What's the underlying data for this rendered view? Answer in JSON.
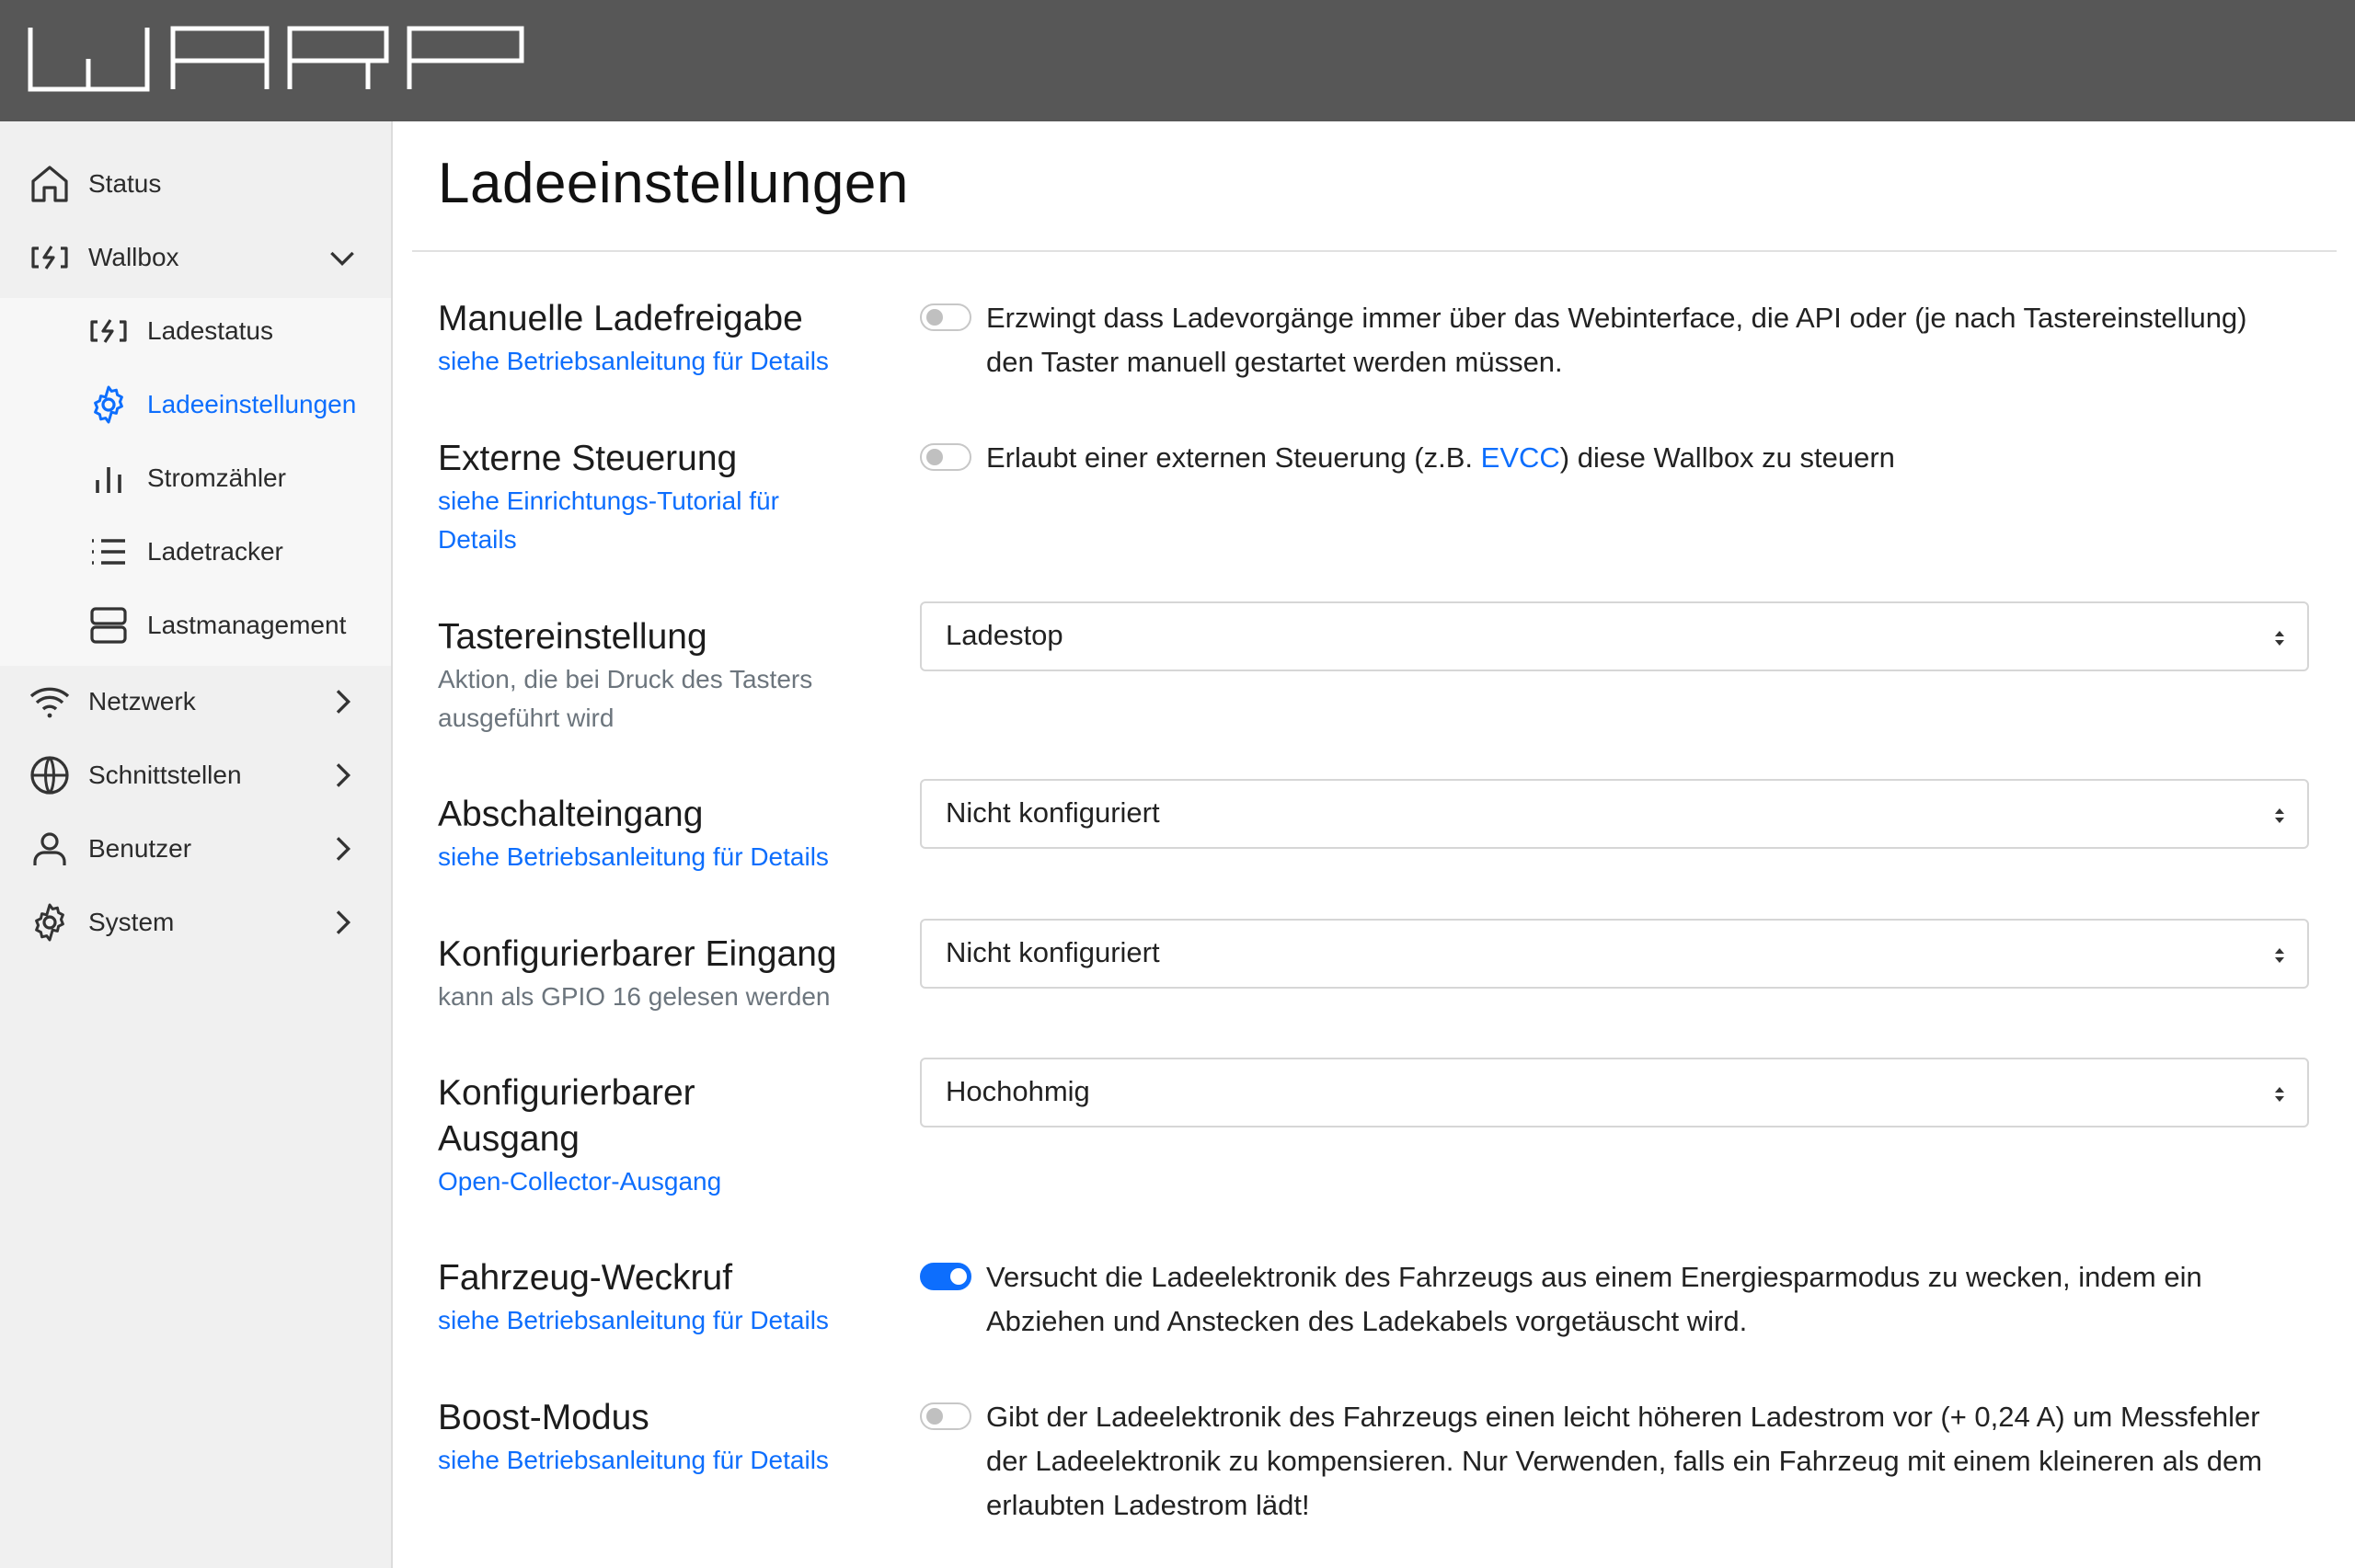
{
  "app": {
    "logo_text": "WARP"
  },
  "sidebar": {
    "items": [
      {
        "label": "Status",
        "icon": "home-icon"
      },
      {
        "label": "Wallbox",
        "icon": "charging-icon"
      },
      {
        "label": "Netzwerk",
        "icon": "wifi-icon"
      },
      {
        "label": "Schnittstellen",
        "icon": "globe-icon"
      },
      {
        "label": "Benutzer",
        "icon": "user-icon"
      },
      {
        "label": "System",
        "icon": "gear-icon"
      }
    ],
    "wallbox_sub": [
      {
        "label": "Ladestatus",
        "icon": "charging-icon"
      },
      {
        "label": "Ladeeinstellungen",
        "icon": "gear-icon",
        "active": true
      },
      {
        "label": "Stromzähler",
        "icon": "bar-chart-icon"
      },
      {
        "label": "Ladetracker",
        "icon": "list-icon"
      },
      {
        "label": "Lastmanagement",
        "icon": "server-icon"
      }
    ]
  },
  "page": {
    "title": "Ladeeinstellungen"
  },
  "settings": {
    "manual": {
      "title": "Manuelle Ladefreigabe",
      "link": "siehe Betriebsanleitung für Details",
      "enabled": false,
      "desc": "Erzwingt dass Ladevorgänge immer über das Webinterface, die API oder (je nach Tastereinstellung) den Taster manuell gestartet werden müssen."
    },
    "external": {
      "title": "Externe Steuerung",
      "link": "siehe Einrichtungs-Tutorial für Details",
      "enabled": false,
      "desc_before": "Erlaubt einer externen Steuerung (z.B. ",
      "desc_link": "EVCC",
      "desc_after": ") diese Wallbox zu steuern"
    },
    "button": {
      "title": "Tastereinstellung",
      "hint": "Aktion, die bei Druck des Tasters ausgeführt wird",
      "value": "Ladestop"
    },
    "shutdown": {
      "title": "Abschalteingang",
      "link": "siehe Betriebsanleitung für Details",
      "value": "Nicht konfiguriert"
    },
    "input": {
      "title": "Konfigurierbarer Eingang",
      "hint": "kann als GPIO 16 gelesen werden",
      "value": "Nicht konfiguriert"
    },
    "output": {
      "title": "Konfigurierbarer Ausgang",
      "link": "Open-Collector-Ausgang",
      "value": "Hochohmig"
    },
    "wakeup": {
      "title": "Fahrzeug-Weckruf",
      "link": "siehe Betriebsanleitung für Details",
      "enabled": true,
      "desc": "Versucht die Ladeelektronik des Fahrzeugs aus einem Energiesparmodus zu wecken, indem ein Abziehen und Anstecken des Ladekabels vorgetäuscht wird."
    },
    "boost": {
      "title": "Boost-Modus",
      "link": "siehe Betriebsanleitung für Details",
      "enabled": false,
      "desc": "Gibt der Ladeelektronik des Fahrzeugs einen leicht höheren Ladestrom vor (+ 0,24 A) um Messfehler der Ladeelektronik zu kompensieren. Nur Verwenden, falls ein Fahrzeug mit einem kleineren als dem erlaubten Ladestrom lädt!"
    }
  },
  "colors": {
    "accent": "#0d6efd",
    "header": "#575757",
    "sidebar": "#f0f0f0"
  }
}
